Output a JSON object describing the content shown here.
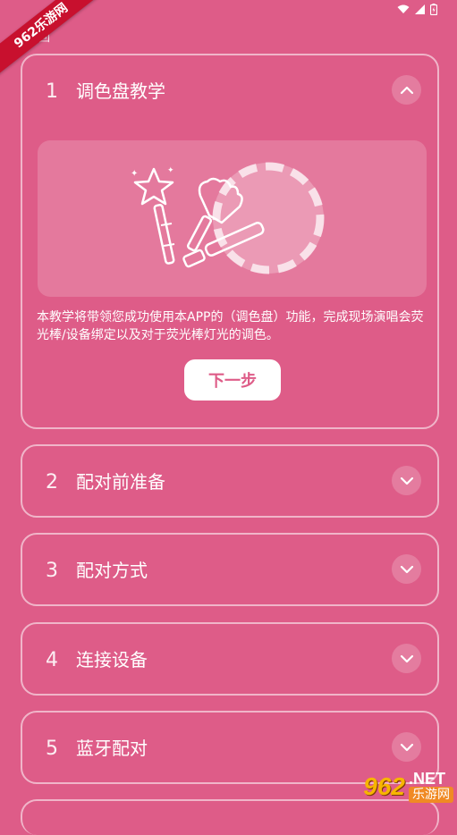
{
  "ribbon": "962乐游网",
  "header": {
    "back_label": "返回"
  },
  "steps": [
    {
      "num": "1",
      "title": "调色盘教学",
      "expanded": true,
      "description": "本教学将带领您成功使用本APP的（调色盘）功能，完成现场演唱会荧光棒/设备绑定以及对于荧光棒灯光的调色。",
      "button_label": "下一步"
    },
    {
      "num": "2",
      "title": "配对前准备",
      "expanded": false
    },
    {
      "num": "3",
      "title": "配对方式",
      "expanded": false
    },
    {
      "num": "4",
      "title": "连接设备",
      "expanded": false
    },
    {
      "num": "5",
      "title": "蓝牙配对",
      "expanded": false
    }
  ],
  "watermark": {
    "logo": "962",
    "domain": ".NET",
    "sub": "乐游网"
  },
  "colors": {
    "background": "#DE5C88",
    "button_text": "#DE5C88",
    "ribbon": "#C8102E"
  },
  "icons": [
    "wifi-icon",
    "signal-icon",
    "battery-icon",
    "chevron-up-icon",
    "chevron-down-icon"
  ]
}
